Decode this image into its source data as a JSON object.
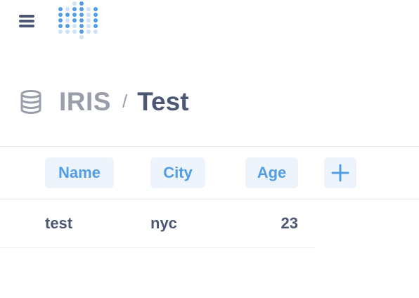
{
  "nav": {
    "menu_icon": "hamburger-menu-icon",
    "logo_icon": "dotted-logo-icon"
  },
  "breadcrumb": {
    "database_icon": "database-icon",
    "database": "IRIS",
    "separator": "/",
    "table": "Test"
  },
  "table": {
    "columns": [
      "Name",
      "City",
      "Age"
    ],
    "add_column_icon": "plus-icon",
    "rows": [
      {
        "name": "test",
        "city": "nyc",
        "age": "23"
      }
    ]
  },
  "colors": {
    "brand": "#509ee3",
    "text_dark": "#4c5773",
    "text_muted": "#9a9eab",
    "header_bg": "#eef4fb"
  }
}
